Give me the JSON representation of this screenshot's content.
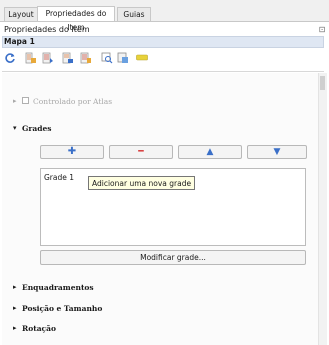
{
  "tabs": [
    {
      "label": "Layout"
    },
    {
      "label": "Propriedades do Item"
    },
    {
      "label": "Guias"
    }
  ],
  "panel": {
    "title": "Propriedades do Item",
    "close_glyph": "⊡",
    "item_name": "Mapa 1"
  },
  "toolbar": {
    "icons": [
      "refresh-icon",
      "map-lock-icon",
      "map-set-icon",
      "map-extent-icon",
      "atlas-icon",
      "zoom-map-icon",
      "label-icon"
    ]
  },
  "sections": {
    "controlled_by_atlas": {
      "label": "Controlado por Atlas",
      "arrow": "▸"
    },
    "grids": {
      "label": "Grades",
      "arrow": "▾"
    }
  },
  "grid_buttons": {
    "add": "✚",
    "remove": "━",
    "up": "▲",
    "down": "▼"
  },
  "grid_list": {
    "items": [
      "Grade 1"
    ]
  },
  "tooltip": "Adicionar uma nova grade",
  "modify_button": "Modificar grade...",
  "collapsed_sections": [
    {
      "label": "Enquadramentos",
      "arrow": "▸"
    },
    {
      "label": "Posição e Tamanho",
      "arrow": "▸"
    },
    {
      "label": "Rotação",
      "arrow": "▸"
    }
  ],
  "colors": {
    "accent_blue": "#3a6fc8",
    "remove_red": "#d63a3a",
    "tooltip_bg": "#ffffe1",
    "label_yellow": "#e8d23a"
  }
}
